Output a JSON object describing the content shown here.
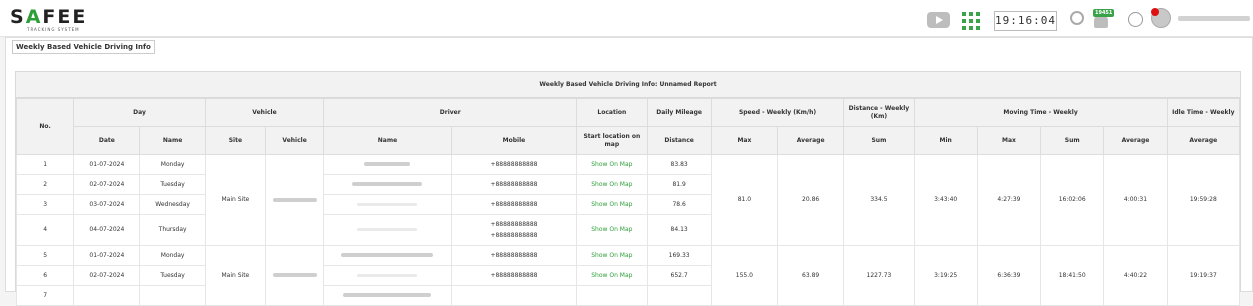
{
  "app": {
    "logo_text_left": "S",
    "logo_text_accent": "A",
    "logo_text_right": "FEE",
    "logo_tagline": "TRACKING SYSTEM"
  },
  "header": {
    "clock": "19:16:04",
    "notification_count": "19451",
    "icons": [
      "youtube-icon",
      "apps-grid-icon",
      "signal-icon",
      "bell-icon",
      "globe-icon",
      "user-avatar-icon"
    ]
  },
  "panel": {
    "legend": "Weekly Based Vehicle Driving Info"
  },
  "report": {
    "title": "Weekly Based Vehicle Driving Info: Unnamed Report",
    "group_headers": {
      "no": "No.",
      "day": "Day",
      "vehicle": "Vehicle",
      "driver": "Driver",
      "location": "Location",
      "mileage": "Daily Mileage",
      "speed": "Speed - Weekly (Km/h)",
      "distance": "Distance - Weekly (Km)",
      "moving": "Moving Time - Weekly",
      "idle": "Idle Time - Weekly"
    },
    "sub_headers": {
      "date": "Date",
      "name": "Name",
      "site": "Site",
      "vehicle": "Vehicle",
      "driver_name": "Name",
      "mobile": "Mobile",
      "location": "Start location on map",
      "distance": "Distance",
      "speed_max": "Max",
      "speed_avg": "Average",
      "dist_sum": "Sum",
      "mov_min": "Min",
      "mov_max": "Max",
      "mov_sum": "Sum",
      "mov_avg": "Average",
      "idle_avg": "Average"
    },
    "groups": [
      {
        "site": "Main Site",
        "speed_max": "81.0",
        "speed_avg": "20.86",
        "dist_sum": "334.5",
        "mov_min": "3:43:40",
        "mov_max": "4:27:39",
        "mov_sum": "16:02:06",
        "mov_avg": "4:00:31",
        "idle_avg": "19:59:28",
        "rows": [
          {
            "no": "1",
            "date": "01-07-2024",
            "day": "Monday",
            "mobile": "+88888888888",
            "mobile2": "",
            "link": "Show On Map",
            "distance": "83.83"
          },
          {
            "no": "2",
            "date": "02-07-2024",
            "day": "Tuesday",
            "mobile": "+88888888888",
            "mobile2": "",
            "link": "Show On Map",
            "distance": "81.9"
          },
          {
            "no": "3",
            "date": "03-07-2024",
            "day": "Wednesday",
            "mobile": "+88888888888",
            "mobile2": "",
            "link": "Show On Map",
            "distance": "78.6"
          },
          {
            "no": "4",
            "date": "04-07-2024",
            "day": "Thursday",
            "mobile": "+88888888888",
            "mobile2": "+88888888888",
            "link": "Show On Map",
            "distance": "84.13"
          }
        ]
      },
      {
        "site": "Main Site",
        "speed_max": "155.0",
        "speed_avg": "63.89",
        "dist_sum": "1227.73",
        "mov_min": "3:19:25",
        "mov_max": "6:36:39",
        "mov_sum": "18:41:50",
        "mov_avg": "4:40:22",
        "idle_avg": "19:19:37",
        "rows": [
          {
            "no": "5",
            "date": "01-07-2024",
            "day": "Monday",
            "mobile": "+88888888888",
            "mobile2": "",
            "link": "Show On Map",
            "distance": "169.33"
          },
          {
            "no": "6",
            "date": "02-07-2024",
            "day": "Tuesday",
            "mobile": "+88888888888",
            "mobile2": "",
            "link": "Show On Map",
            "distance": "652.7"
          },
          {
            "no": "7",
            "date": "",
            "day": "",
            "mobile": "",
            "mobile2": "",
            "link": "",
            "distance": ""
          }
        ]
      }
    ]
  }
}
